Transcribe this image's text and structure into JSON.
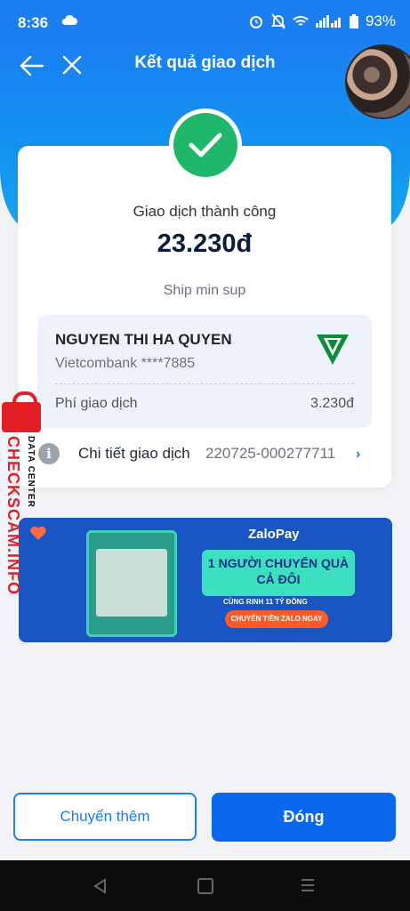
{
  "status_bar": {
    "time": "8:36",
    "battery": "93%"
  },
  "header": {
    "title": "Kết quả giao dịch"
  },
  "result": {
    "status": "Giao dịch thành công",
    "amount": "23.230đ",
    "note": "Ship min sup"
  },
  "recipient": {
    "name": "NGUYEN THI HA QUYEN",
    "bank": "Vietcombank ****7885"
  },
  "fee": {
    "label": "Phí giao dịch",
    "value": "3.230đ"
  },
  "detail": {
    "label": "Chi tiết giao dịch",
    "value": "220725-000277711"
  },
  "banner": {
    "brand": "ZaloPay",
    "headline": "1 NGƯỜI CHUYỂN QUÀ CẢ ĐÔI",
    "sub": "CÙNG RINH 11 TỶ ĐỒNG",
    "cta": "CHUYỂN TIỀN ZALO NGAY"
  },
  "watermark": {
    "line1": "DATA CENTER",
    "line2": "CHECKSCAM.INFO"
  },
  "actions": {
    "secondary": "Chuyển thêm",
    "primary": "Đóng"
  },
  "colors": {
    "primary": "#0a68ee",
    "header": "#1b7ff2",
    "success": "#1fb86a",
    "watermark": "#e31f26"
  }
}
